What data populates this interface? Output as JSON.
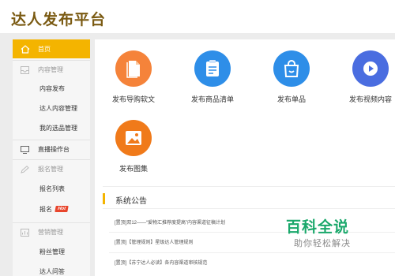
{
  "header": {
    "title": "达人发布平台"
  },
  "sidebar": {
    "home": "首页",
    "content_section": "内容管理",
    "content_items": [
      "内容发布",
      "达人内容管理",
      "我的选品管理"
    ],
    "live_section": "直播操作台",
    "signup_section": "报名管理",
    "signup_items": [
      "报名列表",
      "报名"
    ],
    "hot_badge": "Hot",
    "marketing_section": "营销管理",
    "marketing_items": [
      "粉丝管理",
      "达人问答"
    ]
  },
  "tiles": [
    {
      "label": "发布导购软文",
      "icon": "document-icon",
      "color": "#f5833a"
    },
    {
      "label": "发布商品清单",
      "icon": "clipboard-list-icon",
      "color": "#2e8ee8"
    },
    {
      "label": "发布单品",
      "icon": "shopping-bag-icon",
      "color": "#2e8ee8"
    },
    {
      "label": "发布视频内容",
      "icon": "video-play-icon",
      "color": "#4a6de0"
    },
    {
      "label": "发布图集",
      "icon": "image-icon",
      "color": "#f07a1a"
    }
  ],
  "notice": {
    "title": "系统公告",
    "rows": [
      "[置顶]双12——“爱物汇推荐度提高”内容渠道征稿计划",
      "[置顶]【管理规则】星级达人管理规则",
      "[置顶]【苏宁达人必读】各内容渠道审核规范"
    ]
  },
  "watermark": {
    "big": "百科全说",
    "small": "助你轻松解决"
  }
}
